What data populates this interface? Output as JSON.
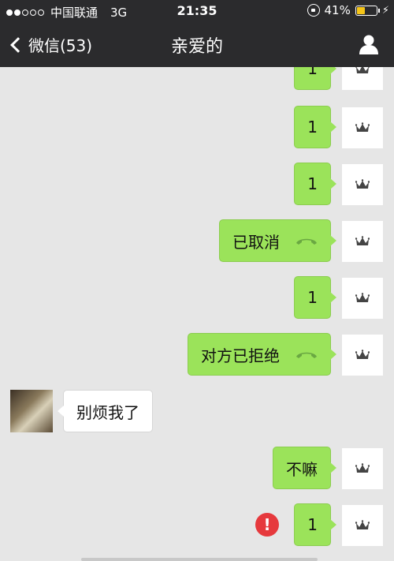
{
  "status_bar": {
    "carrier": "中国联通",
    "network": "3G",
    "time": "21:35",
    "battery": "41%",
    "battery_level": 0.41,
    "battery_color": "#f5c518"
  },
  "nav": {
    "back_label": "微信(53)",
    "title": "亲爱的",
    "profile_icon": "person-icon"
  },
  "messages": [
    {
      "sender": "me",
      "text": "1"
    },
    {
      "sender": "me",
      "text": "1"
    },
    {
      "sender": "me",
      "text": "1"
    },
    {
      "sender": "me",
      "text": "已取消",
      "icon": "phone-icon"
    },
    {
      "sender": "me",
      "text": "1"
    },
    {
      "sender": "me",
      "text": "对方已拒绝",
      "icon": "phone-icon"
    },
    {
      "sender": "her",
      "text": "别烦我了"
    },
    {
      "sender": "me",
      "text": "不嘛"
    },
    {
      "sender": "me",
      "text": "1",
      "failed": true,
      "error_mark": "!"
    }
  ],
  "colors": {
    "bubble_out": "#9be35a",
    "bubble_in": "#ffffff",
    "bar": "#2b2b2d",
    "background": "#e6e6e6",
    "error": "#e6393d"
  }
}
